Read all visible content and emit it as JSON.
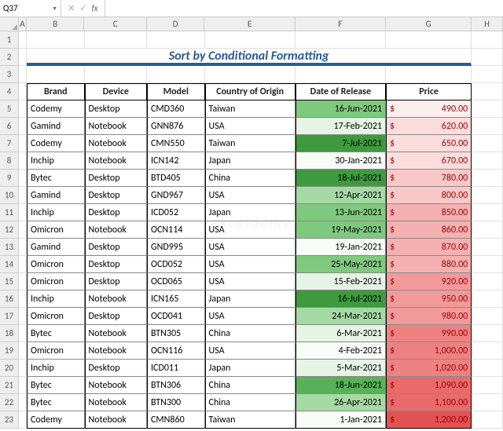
{
  "namebox": {
    "ref": "Q37"
  },
  "title": "Sort by Conditional Formatting",
  "columns": [
    "A",
    "B",
    "C",
    "D",
    "E",
    "F",
    "G",
    "H"
  ],
  "rowNumbers": [
    "1",
    "2",
    "3",
    "4",
    "5",
    "6",
    "7",
    "8",
    "9",
    "10",
    "11",
    "12",
    "13",
    "14",
    "15",
    "16",
    "17",
    "18",
    "19",
    "20",
    "21",
    "22",
    "23"
  ],
  "colWidths": {
    "A": 10,
    "B": 74,
    "C": 80,
    "D": 74,
    "E": 116,
    "F": 116,
    "G": 110,
    "H": 40
  },
  "headers": {
    "b": "Brand",
    "c": "Device",
    "d": "Model",
    "e": "Country of Origin",
    "f": "Date of Release",
    "g": "Price"
  },
  "chart_data": {
    "type": "table",
    "title": "Sort by Conditional Formatting",
    "columns": [
      "Brand",
      "Device",
      "Model",
      "Country of Origin",
      "Date of Release",
      "Price"
    ],
    "rows": [
      {
        "brand": "Codemy",
        "device": "Desktop",
        "model": "CMD360",
        "country": "Taiwan",
        "date": "16-Jun-2021",
        "price": "490.00",
        "dShade": "g5",
        "pShade": "r1"
      },
      {
        "brand": "Gamind",
        "device": "Notebook",
        "model": "GNN876",
        "country": "USA",
        "date": "17-Feb-2021",
        "price": "620.00",
        "dShade": "g2",
        "pShade": "r2"
      },
      {
        "brand": "Codemy",
        "device": "Notebook",
        "model": "CMN550",
        "country": "Taiwan",
        "date": "7-Jul-2021",
        "price": "650.00",
        "dShade": "g7",
        "pShade": "r2"
      },
      {
        "brand": "Inchip",
        "device": "Notebook",
        "model": "ICN142",
        "country": "Japan",
        "date": "30-Jan-2021",
        "price": "670.00",
        "dShade": "g1",
        "pShade": "r2"
      },
      {
        "brand": "Bytec",
        "device": "Desktop",
        "model": "BTD405",
        "country": "China",
        "date": "18-Jul-2021",
        "price": "780.00",
        "dShade": "g7",
        "pShade": "r3"
      },
      {
        "brand": "Gamind",
        "device": "Desktop",
        "model": "GND967",
        "country": "USA",
        "date": "12-Apr-2021",
        "price": "800.00",
        "dShade": "g4",
        "pShade": "r3"
      },
      {
        "brand": "Inchip",
        "device": "Desktop",
        "model": "ICD052",
        "country": "Japan",
        "date": "13-Jun-2021",
        "price": "850.00",
        "dShade": "g5",
        "pShade": "r4"
      },
      {
        "brand": "Omicron",
        "device": "Notebook",
        "model": "OCN114",
        "country": "USA",
        "date": "19-May-2021",
        "price": "860.00",
        "dShade": "g5",
        "pShade": "r4"
      },
      {
        "brand": "Gamind",
        "device": "Desktop",
        "model": "GND995",
        "country": "USA",
        "date": "19-Jan-2021",
        "price": "870.00",
        "dShade": "g1",
        "pShade": "r4"
      },
      {
        "brand": "Omicron",
        "device": "Desktop",
        "model": "OCD052",
        "country": "USA",
        "date": "25-May-2021",
        "price": "880.00",
        "dShade": "g5",
        "pShade": "r4"
      },
      {
        "brand": "Omicron",
        "device": "Desktop",
        "model": "OCD065",
        "country": "USA",
        "date": "15-Feb-2021",
        "price": "920.00",
        "dShade": "g2",
        "pShade": "r5"
      },
      {
        "brand": "Inchip",
        "device": "Notebook",
        "model": "ICN165",
        "country": "Japan",
        "date": "16-Jul-2021",
        "price": "950.00",
        "dShade": "g7",
        "pShade": "r5"
      },
      {
        "brand": "Omicron",
        "device": "Desktop",
        "model": "OCD041",
        "country": "USA",
        "date": "24-Mar-2021",
        "price": "980.00",
        "dShade": "g4",
        "pShade": "r5"
      },
      {
        "brand": "Bytec",
        "device": "Notebook",
        "model": "BTN305",
        "country": "China",
        "date": "6-Mar-2021",
        "price": "990.00",
        "dShade": "g2",
        "pShade": "r6"
      },
      {
        "brand": "Omicron",
        "device": "Notebook",
        "model": "OCN116",
        "country": "USA",
        "date": "4-Feb-2021",
        "price": "1,000.00",
        "dShade": "g1",
        "pShade": "r6"
      },
      {
        "brand": "Inchip",
        "device": "Desktop",
        "model": "ICD011",
        "country": "Japan",
        "date": "5-Mar-2021",
        "price": "1,020.00",
        "dShade": "g2",
        "pShade": "r6"
      },
      {
        "brand": "Bytec",
        "device": "Notebook",
        "model": "BTN306",
        "country": "China",
        "date": "18-Jun-2021",
        "price": "1,090.00",
        "dShade": "g6",
        "pShade": "r7"
      },
      {
        "brand": "Bytec",
        "device": "Notebook",
        "model": "BTN300",
        "country": "China",
        "date": "26-Apr-2021",
        "price": "1,100.00",
        "dShade": "g4",
        "pShade": "r7"
      },
      {
        "brand": "Codemy",
        "device": "Notebook",
        "model": "CMN860",
        "country": "Taiwan",
        "date": "1-Jan-2021",
        "price": "1,200.00",
        "dShade": "g1",
        "pShade": "r8"
      }
    ]
  },
  "currency": "$",
  "watermark": "exceldemy"
}
